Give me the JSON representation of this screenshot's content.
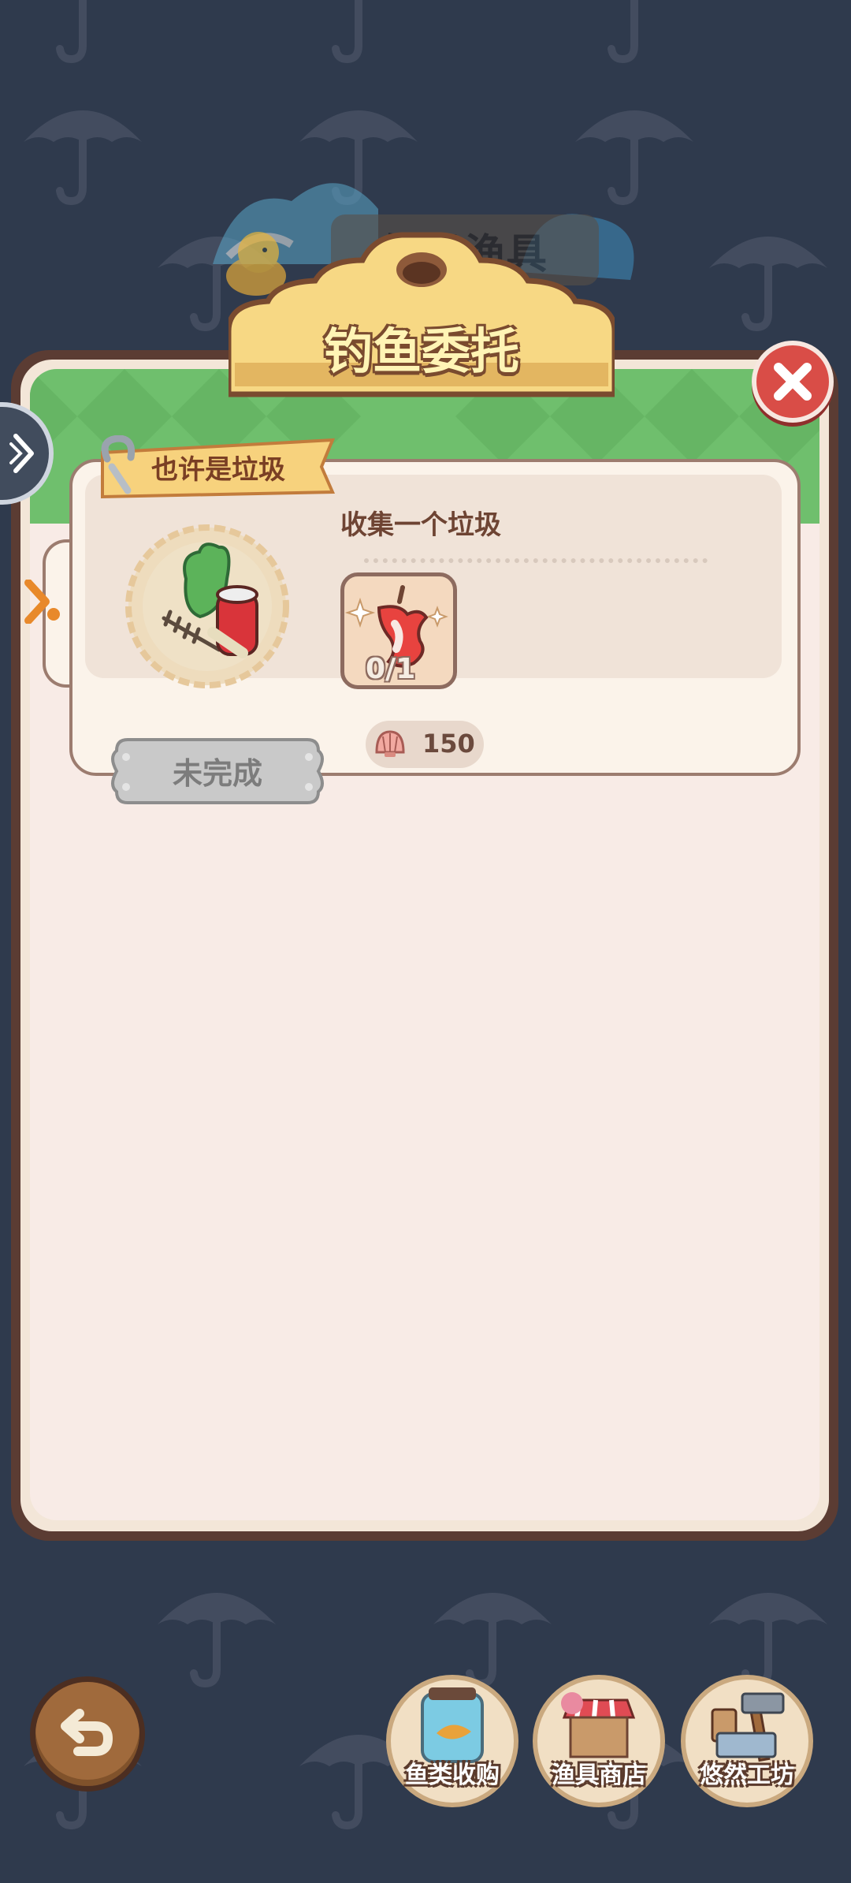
{
  "background": {
    "header_title": "饰品渔具"
  },
  "dialog": {
    "title": "钓鱼委托",
    "close_icon": "close-icon",
    "side_tab_icon": "chevron-right-icon"
  },
  "task": {
    "category": "也许是垃圾",
    "description": "收集一个垃圾",
    "item_icon": "bitten-apple-trash-icon",
    "progress": "0/1",
    "reward_icon": "shell-icon",
    "reward_value": "150",
    "status": "未完成"
  },
  "bottom_nav": {
    "back_icon": "undo-arrow-icon",
    "items": [
      {
        "label": "鱼类收购",
        "icon": "fish-jar-icon"
      },
      {
        "label": "渔具商店",
        "icon": "shop-icon"
      },
      {
        "label": "悠然工坊",
        "icon": "hammer-workshop-icon"
      }
    ]
  },
  "colors": {
    "background": "#2f3a4d",
    "panel_border": "#5b3c33",
    "accent_green": "#6fbf6d",
    "close_red": "#d94d47",
    "title_yellow": "#fff4b5"
  }
}
